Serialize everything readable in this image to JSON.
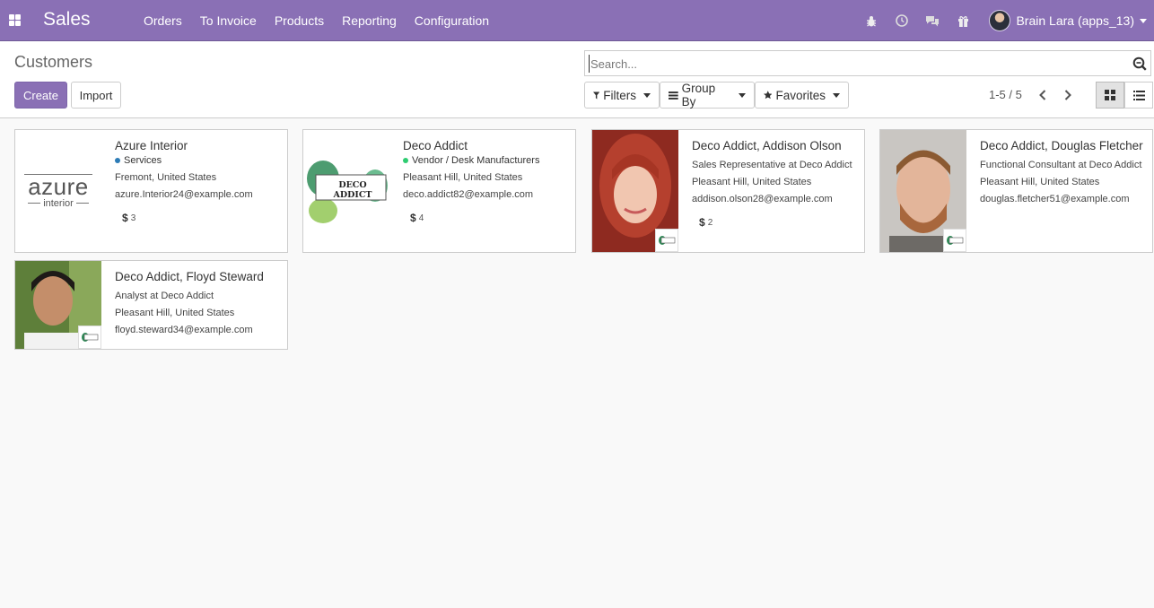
{
  "navbar": {
    "app_name": "Sales",
    "menu": [
      "Orders",
      "To Invoice",
      "Products",
      "Reporting",
      "Configuration"
    ],
    "user_name": "Brain Lara (apps_13)",
    "accent_color": "#8a70b5"
  },
  "control_panel": {
    "breadcrumb": "Customers",
    "create_label": "Create",
    "import_label": "Import",
    "search_placeholder": "Search...",
    "filters_label": "Filters",
    "groupby_label": "Group By",
    "favorites_label": "Favorites",
    "pager": "1-5 / 5"
  },
  "customers": [
    {
      "name": "Azure Interior",
      "tag": "Services",
      "tag_color": "#2c7bb6",
      "job": "",
      "location": "Fremont, United States",
      "email": "azure.Interior24@example.com",
      "badge": "3",
      "logo_text_main": "azure",
      "logo_text_sub": "interior"
    },
    {
      "name": "Deco Addict",
      "tag": "Vendor / Desk Manufacturers",
      "tag_color": "#2ecc71",
      "job": "",
      "location": "Pleasant Hill, United States",
      "email": "deco.addict82@example.com",
      "badge": "4",
      "logo_text_main": "DECO ADDICT"
    },
    {
      "name": "Deco Addict, Addison Olson",
      "job": "Sales Representative at Deco Addict",
      "location": "Pleasant Hill, United States",
      "email": "addison.olson28@example.com",
      "badge": "2"
    },
    {
      "name": "Deco Addict, Douglas Fletcher",
      "job": "Functional Consultant at Deco Addict",
      "location": "Pleasant Hill, United States",
      "email": "douglas.fletcher51@example.com"
    },
    {
      "name": "Deco Addict, Floyd Steward",
      "job": "Analyst at Deco Addict",
      "location": "Pleasant Hill, United States",
      "email": "floyd.steward34@example.com"
    }
  ]
}
